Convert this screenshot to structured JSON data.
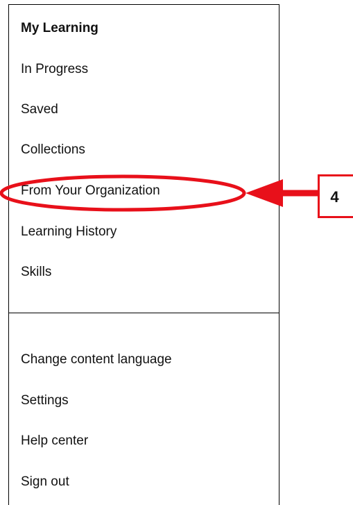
{
  "menu": {
    "primary_items": [
      {
        "label": "My Learning"
      },
      {
        "label": "In Progress"
      },
      {
        "label": "Saved"
      },
      {
        "label": "Collections"
      },
      {
        "label": "From Your Organization"
      },
      {
        "label": "Learning History"
      },
      {
        "label": "Skills"
      }
    ],
    "secondary_items": [
      {
        "label": "Change content language"
      },
      {
        "label": "Settings"
      },
      {
        "label": "Help center"
      },
      {
        "label": "Sign out"
      }
    ]
  },
  "annotation": {
    "step_number": "4",
    "highlighted_item": "From Your Organization",
    "color": "#e8101a"
  }
}
